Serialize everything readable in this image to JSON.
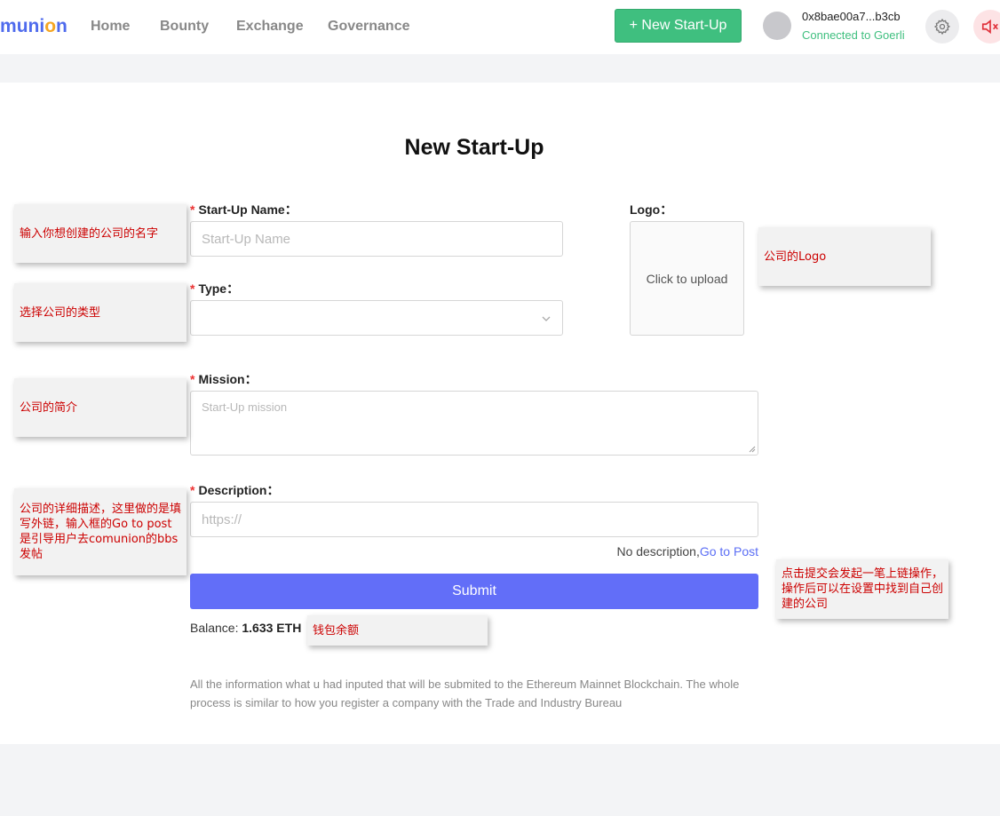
{
  "header": {
    "logo_prefix": "m",
    "logo_mid": "uni",
    "logo_o": "o",
    "logo_suffix": "n",
    "nav": [
      "Home",
      "Bounty",
      "Exchange",
      "Governance"
    ],
    "new_startup_button": "+ New Start-Up",
    "wallet_address": "0x8bae00a7...b3cb",
    "connection_status": "Connected to Goerli",
    "settings_icon": "gear-icon",
    "sound_icon": "speaker-icon"
  },
  "form": {
    "title": "New Start-Up",
    "name_label": "Start-Up Name：",
    "name_placeholder": "Start-Up Name",
    "type_label": "Type：",
    "type_value": "",
    "logo_label": "Logo：",
    "logo_upload": "Click to upload",
    "mission_label": "Mission：",
    "mission_placeholder": "Start-Up mission",
    "description_label": "Description：",
    "description_placeholder": "https://",
    "description_hint": "No description,",
    "description_link": "Go to Post",
    "submit": "Submit",
    "balance_label": "Balance:",
    "balance_value": "1.633 ETH",
    "info": "All the information what u had inputed that will be submited to the Ethereum Mainnet Blockchain. The whole process is similar to how you register a company with the Trade and Industry Bureau"
  },
  "annotations": {
    "name": "输入你想创建的公司的名字",
    "type": "选择公司的类型",
    "mission": "公司的简介",
    "description": "公司的详细描述，这里做的是填写外链，输入框的Go to post 是引导用户去comunion的bbs发帖",
    "logo": "公司的Logo",
    "submit": "点击提交会发起一笔上链操作，操作后可以在设置中找到自己创建的公司",
    "balance": "钱包余额"
  },
  "colors": {
    "primary": "#626ef8",
    "success": "#3fbf7f",
    "required": "#e33333",
    "note_text": "#cc0000"
  }
}
